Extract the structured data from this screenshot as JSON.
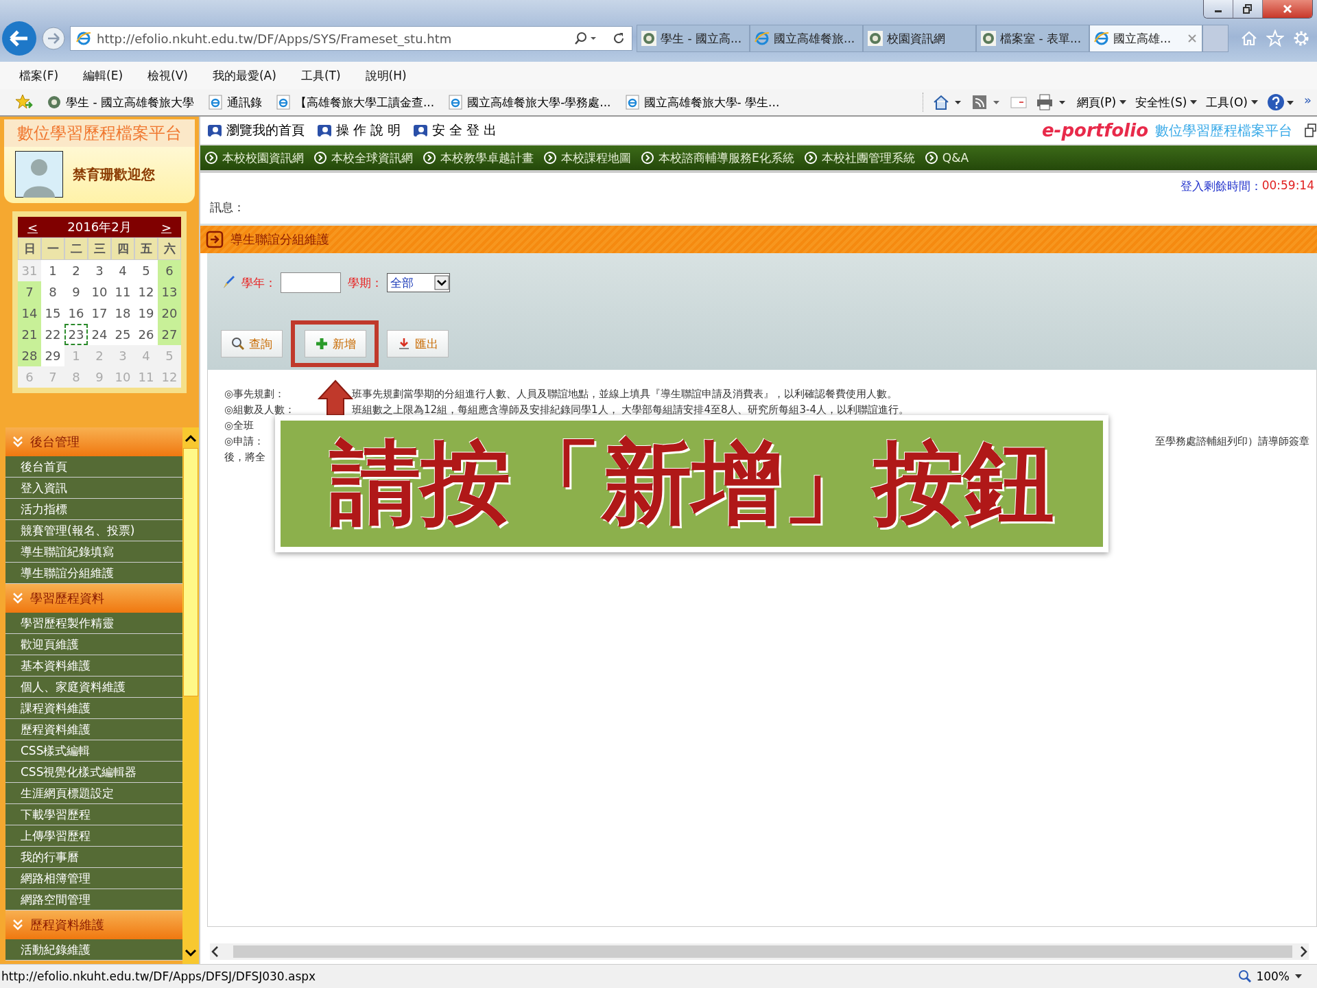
{
  "browser": {
    "address": "http://efolio.nkuht.edu.tw/DF/Apps/SYS/Frameset_stu.htm",
    "tabs": [
      {
        "label": "學生 - 國立高...",
        "kind": "seal",
        "selected": false
      },
      {
        "label": "國立高雄餐旅...",
        "kind": "ie",
        "selected": false
      },
      {
        "label": "校園資訊網",
        "kind": "seal",
        "selected": false
      },
      {
        "label": "檔案室 - 表單...",
        "kind": "seal",
        "selected": false
      },
      {
        "label": "國立高雄...",
        "kind": "ie",
        "selected": true
      }
    ],
    "menu": [
      "檔案(F)",
      "編輯(E)",
      "檢視(V)",
      "我的最愛(A)",
      "工具(T)",
      "說明(H)"
    ],
    "favorites": [
      {
        "label": "學生 - 國立高雄餐旅大學",
        "kind": "seal"
      },
      {
        "label": "通訊錄",
        "kind": "ie"
      },
      {
        "label": "【高雄餐旅大學工讀金查...",
        "kind": "ie"
      },
      {
        "label": "國立高雄餐旅大學-學務處...",
        "kind": "ie"
      },
      {
        "label": "國立高雄餐旅大學- 學生...",
        "kind": "ie"
      }
    ],
    "command_menus": [
      "網頁(P)",
      "安全性(S)",
      "工具(O)"
    ],
    "more": "»",
    "status_url": "http://efolio.nkuht.edu.tw/DF/Apps/DFSJ/DFSJ030.aspx",
    "zoom": "100%"
  },
  "sidebar": {
    "platform_title": "數位學習歷程檔案平台",
    "welcome": "禁育珊歡迎您",
    "calendar": {
      "prev": "<",
      "title": "2016年2月",
      "next": ">",
      "weekdays": [
        "日",
        "一",
        "二",
        "三",
        "四",
        "五",
        "六"
      ],
      "weeks": [
        [
          {
            "day": "31",
            "kind": "other",
            "selected": false
          },
          {
            "day": "1",
            "kind": "weekday",
            "selected": false
          },
          {
            "day": "2",
            "kind": "weekday",
            "selected": false
          },
          {
            "day": "3",
            "kind": "weekday",
            "selected": false
          },
          {
            "day": "4",
            "kind": "weekday",
            "selected": false
          },
          {
            "day": "5",
            "kind": "weekday",
            "selected": false
          },
          {
            "day": "6",
            "kind": "weekend",
            "selected": false
          }
        ],
        [
          {
            "day": "7",
            "kind": "weekend",
            "selected": false
          },
          {
            "day": "8",
            "kind": "weekday",
            "selected": false
          },
          {
            "day": "9",
            "kind": "weekday",
            "selected": false
          },
          {
            "day": "10",
            "kind": "weekday",
            "selected": false
          },
          {
            "day": "11",
            "kind": "weekday",
            "selected": false
          },
          {
            "day": "12",
            "kind": "weekday",
            "selected": false
          },
          {
            "day": "13",
            "kind": "weekend",
            "selected": false
          }
        ],
        [
          {
            "day": "14",
            "kind": "weekend",
            "selected": false
          },
          {
            "day": "15",
            "kind": "weekday",
            "selected": false
          },
          {
            "day": "16",
            "kind": "weekday",
            "selected": false
          },
          {
            "day": "17",
            "kind": "weekday",
            "selected": false
          },
          {
            "day": "18",
            "kind": "weekday",
            "selected": false
          },
          {
            "day": "19",
            "kind": "weekday",
            "selected": false
          },
          {
            "day": "20",
            "kind": "weekend",
            "selected": false
          }
        ],
        [
          {
            "day": "21",
            "kind": "weekend",
            "selected": false
          },
          {
            "day": "22",
            "kind": "weekday",
            "selected": false
          },
          {
            "day": "23",
            "kind": "weekday",
            "selected": true
          },
          {
            "day": "24",
            "kind": "weekday",
            "selected": false
          },
          {
            "day": "25",
            "kind": "weekday",
            "selected": false
          },
          {
            "day": "26",
            "kind": "weekday",
            "selected": false
          },
          {
            "day": "27",
            "kind": "weekend",
            "selected": false
          }
        ],
        [
          {
            "day": "28",
            "kind": "weekend",
            "selected": false
          },
          {
            "day": "29",
            "kind": "weekday",
            "selected": false
          },
          {
            "day": "1",
            "kind": "other",
            "selected": false
          },
          {
            "day": "2",
            "kind": "other",
            "selected": false
          },
          {
            "day": "3",
            "kind": "other",
            "selected": false
          },
          {
            "day": "4",
            "kind": "other",
            "selected": false
          },
          {
            "day": "5",
            "kind": "other",
            "selected": false
          }
        ],
        [
          {
            "day": "6",
            "kind": "other",
            "selected": false
          },
          {
            "day": "7",
            "kind": "other",
            "selected": false
          },
          {
            "day": "8",
            "kind": "other",
            "selected": false
          },
          {
            "day": "9",
            "kind": "other",
            "selected": false
          },
          {
            "day": "10",
            "kind": "other",
            "selected": false
          },
          {
            "day": "11",
            "kind": "other",
            "selected": false
          },
          {
            "day": "12",
            "kind": "other",
            "selected": false
          }
        ]
      ]
    },
    "menu_sections": [
      {
        "title": "後台管理",
        "items": [
          "後台首頁",
          "登入資訊",
          "活力指標",
          "競賽管理(報名、投票)",
          "導生聯誼紀錄填寫",
          "導生聯誼分組維護"
        ]
      },
      {
        "title": "學習歷程資料",
        "items": [
          "學習歷程製作精靈",
          "歡迎頁維護",
          "基本資料維護",
          "個人、家庭資料維護",
          "課程資料維護",
          "歷程資料維護",
          "CSS樣式編輯",
          "CSS視覺化樣式編輯器",
          "生涯網頁標題設定",
          "下載學習歷程",
          "上傳學習歷程",
          "我的行事曆",
          "網路相簿管理",
          "網路空間管理"
        ]
      },
      {
        "title": "歷程資料維護",
        "items": [
          "活動紀錄維護"
        ]
      }
    ]
  },
  "header": {
    "links": [
      "瀏覽我的首頁",
      "操 作 說 明",
      "安 全 登 出"
    ],
    "brand": "e-portfolio",
    "brand_subtitle": "數位學習歷程檔案平台"
  },
  "nav": [
    "本校校園資訊網",
    "本校全球資訊網",
    "本校教學卓越計畫",
    "本校課程地圖",
    "本校諮商輔導服務E化系統",
    "本校社團管理系統",
    "Q&A"
  ],
  "session": {
    "label": "登入剩餘時間：",
    "time": "00:59:14"
  },
  "message_label": "訊息：",
  "section_title": "導生聯誼分組維護",
  "filters": {
    "year_label": "學年：",
    "semester_label": "學期：",
    "semester_value": "全部"
  },
  "buttons": [
    {
      "label": "查詢",
      "kind": "search",
      "highlighted": false
    },
    {
      "label": "新增",
      "kind": "plus",
      "highlighted": true
    },
    {
      "label": "匯出",
      "kind": "export",
      "highlighted": false
    }
  ],
  "notes": [
    {
      "kind": "split",
      "left": "◎事先規劃：",
      "right": "班事先規劃當學期的分組進行人數、人員及聯誼地點，並線上填具『導生聯誼申請及消費表』，以利確認餐費使用人數。"
    },
    {
      "kind": "split",
      "left": "◎組數及人數：",
      "right": "班組數之上限為12組，每組應含導師及安排紀錄同學1人， 大學部每組請安排4至8人、研究所每組3-4人，以利聯誼進行。"
    },
    {
      "kind": "left",
      "left": "◎全班"
    },
    {
      "kind": "edge",
      "left": "◎申請：",
      "right": "至學務處諮輔組列印）請導師簽章"
    },
    {
      "kind": "left",
      "left": "後，將全"
    }
  ],
  "callout": "請按「新增」按鈕"
}
